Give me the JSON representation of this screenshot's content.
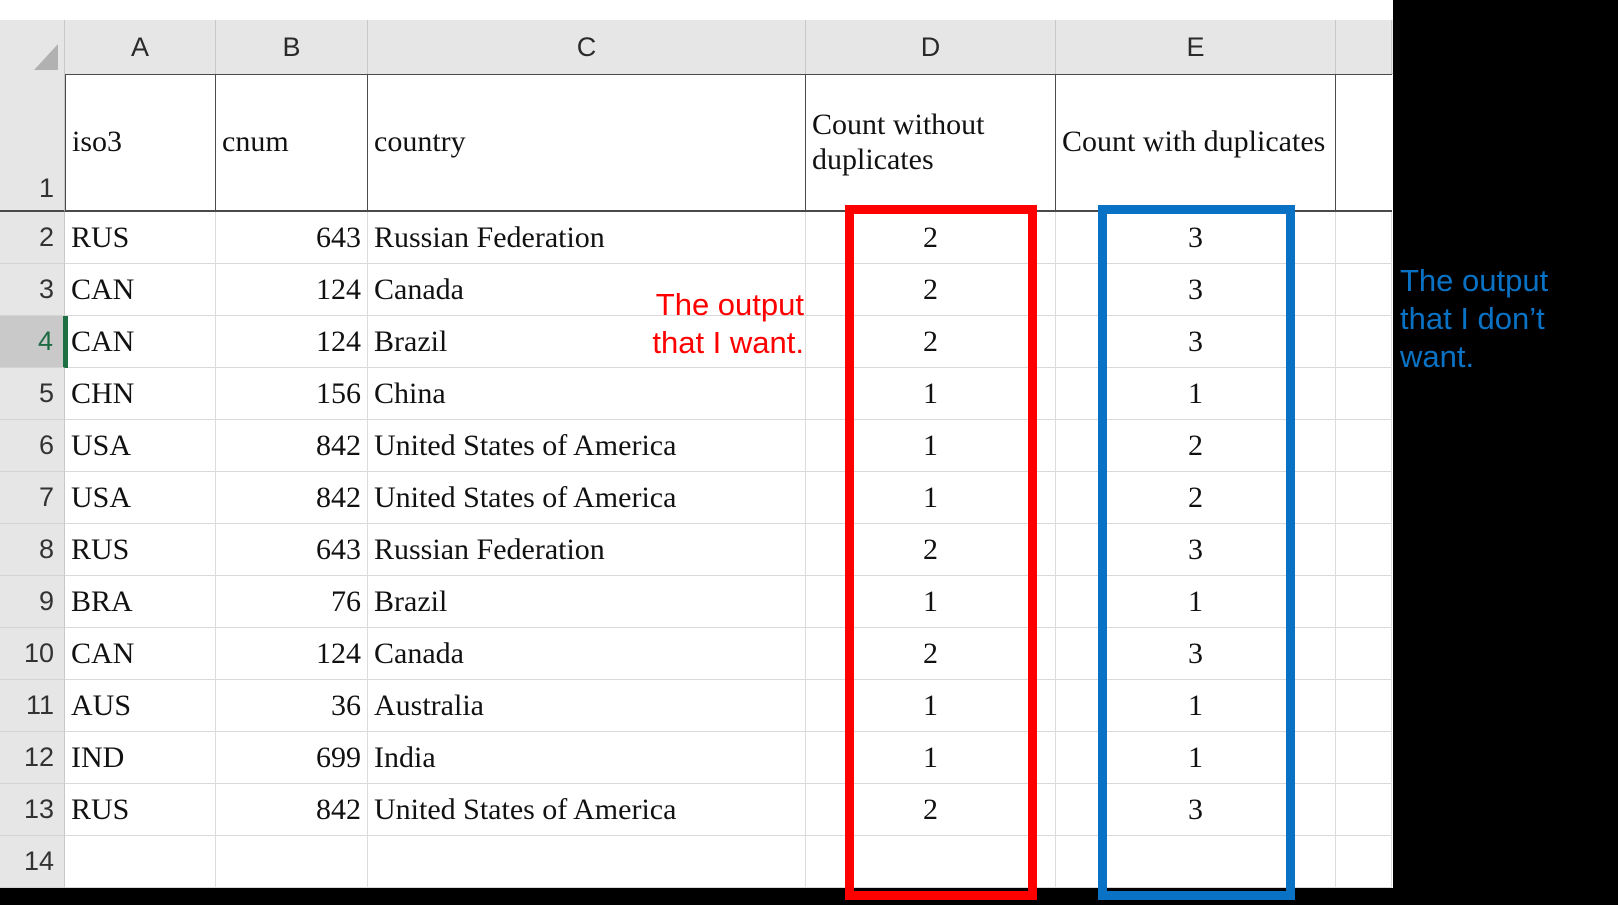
{
  "app": "excel-spreadsheet",
  "column_headers": [
    "A",
    "B",
    "C",
    "D",
    "E",
    ""
  ],
  "sheet_header_row": {
    "row_number": "1",
    "A": "iso3",
    "B": "cnum",
    "C": "country",
    "D": "Count without duplicates",
    "E": "Count with duplicates",
    "F": ""
  },
  "rows": [
    {
      "n": "2",
      "iso3": "RUS",
      "cnum": "643",
      "country": "Russian Federation",
      "count_without_duplicates": "2",
      "count_with_duplicates": "3",
      "active": false
    },
    {
      "n": "3",
      "iso3": "CAN",
      "cnum": "124",
      "country": "Canada",
      "count_without_duplicates": "2",
      "count_with_duplicates": "3",
      "active": false
    },
    {
      "n": "4",
      "iso3": "CAN",
      "cnum": "124",
      "country": "Brazil",
      "count_without_duplicates": "2",
      "count_with_duplicates": "3",
      "active": true
    },
    {
      "n": "5",
      "iso3": "CHN",
      "cnum": "156",
      "country": "China",
      "count_without_duplicates": "1",
      "count_with_duplicates": "1",
      "active": false
    },
    {
      "n": "6",
      "iso3": "USA",
      "cnum": "842",
      "country": "United States of America",
      "count_without_duplicates": "1",
      "count_with_duplicates": "2",
      "active": false
    },
    {
      "n": "7",
      "iso3": "USA",
      "cnum": "842",
      "country": "United States of America",
      "count_without_duplicates": "1",
      "count_with_duplicates": "2",
      "active": false
    },
    {
      "n": "8",
      "iso3": "RUS",
      "cnum": "643",
      "country": "Russian Federation",
      "count_without_duplicates": "2",
      "count_with_duplicates": "3",
      "active": false
    },
    {
      "n": "9",
      "iso3": "BRA",
      "cnum": "76",
      "country": "Brazil",
      "count_without_duplicates": "1",
      "count_with_duplicates": "1",
      "active": false
    },
    {
      "n": "10",
      "iso3": "CAN",
      "cnum": "124",
      "country": "Canada",
      "count_without_duplicates": "2",
      "count_with_duplicates": "3",
      "active": false
    },
    {
      "n": "11",
      "iso3": "AUS",
      "cnum": "36",
      "country": "Australia",
      "count_without_duplicates": "1",
      "count_with_duplicates": "1",
      "active": false
    },
    {
      "n": "12",
      "iso3": "IND",
      "cnum": "699",
      "country": "India",
      "count_without_duplicates": "1",
      "count_with_duplicates": "1",
      "active": false
    },
    {
      "n": "13",
      "iso3": "RUS",
      "cnum": "842",
      "country": "United States of America",
      "count_without_duplicates": "2",
      "count_with_duplicates": "3",
      "active": false
    },
    {
      "n": "14",
      "iso3": "",
      "cnum": "",
      "country": "",
      "count_without_duplicates": "",
      "count_with_duplicates": "",
      "active": false
    }
  ],
  "annotations": {
    "red": {
      "text": "The output that I want.",
      "color": "#ff0000",
      "targets_column": "D"
    },
    "blue": {
      "text": "The output that I don’t want.",
      "color": "#0a72c4",
      "targets_column": "E"
    }
  },
  "colors": {
    "header_fill": "#e6e6e6",
    "active_header_fill": "#c9c9c9",
    "selection_green": "#1d7044",
    "gridline": "#d9d9d9",
    "background_outside": "#000000"
  }
}
